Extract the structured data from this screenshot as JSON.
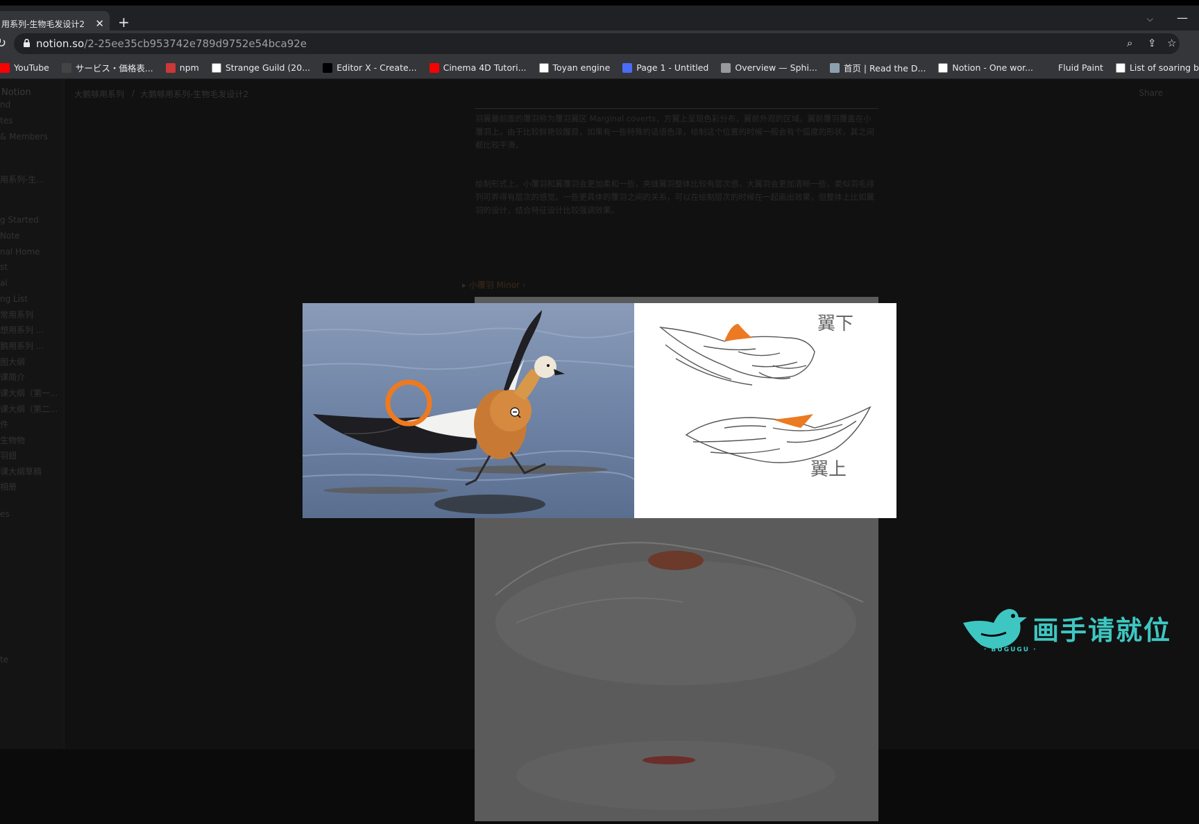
{
  "browser": {
    "tab_title": "用系列-生物毛发设计2",
    "url_host": "notion.so",
    "url_path": "/2-25ee35cb953742e789d9752e54bca92e",
    "bookmarks": [
      {
        "label": "YouTube",
        "icon": "youtube-icon",
        "color": "#ff0000"
      },
      {
        "label": "サービス・価格表...",
        "icon": "price-icon",
        "color": "#444444"
      },
      {
        "label": "npm",
        "icon": "npm-icon",
        "color": "#cb3837"
      },
      {
        "label": "Strange Guild (20...",
        "icon": "strange-guild-icon",
        "color": "#ffffff"
      },
      {
        "label": "Editor X - Create...",
        "icon": "editorx-icon",
        "color": "#000000"
      },
      {
        "label": "Cinema 4D Tutori...",
        "icon": "youtube-icon",
        "color": "#ff0000"
      },
      {
        "label": "Toyan engine",
        "icon": "toyan-icon",
        "color": "#ffffff"
      },
      {
        "label": "Page 1 - Untitled",
        "icon": "layers-icon",
        "color": "#4a6cf7"
      },
      {
        "label": "Overview — Sphi...",
        "icon": "sphinx-icon",
        "color": "#999999"
      },
      {
        "label": "首页 | Read the D...",
        "icon": "readthedocs-icon",
        "color": "#8ca1af"
      },
      {
        "label": "Notion - One wor...",
        "icon": "notion-icon",
        "color": "#ffffff"
      },
      {
        "label": "Fluid Paint",
        "icon": "",
        "color": ""
      },
      {
        "label": "List of soaring bir...",
        "icon": "wikipedia-icon",
        "color": "#ffffff"
      }
    ]
  },
  "notion": {
    "workspace": "Notion",
    "sidebar_items": [
      {
        "label": "nd"
      },
      {
        "label": "tes"
      },
      {
        "label": "& Members"
      },
      {
        "label": "用系列-生..."
      },
      {
        "label": "g Started"
      },
      {
        "label": "Note"
      },
      {
        "label": "nal Home"
      },
      {
        "label": "st"
      },
      {
        "label": "al"
      },
      {
        "label": "ng List"
      },
      {
        "label": "常用系列"
      },
      {
        "label": "想用系列 ..."
      },
      {
        "label": "鹅用系列 ..."
      },
      {
        "label": "图大纲"
      },
      {
        "label": "课简介"
      },
      {
        "label": "课大纲（第一..."
      },
      {
        "label": "课大纲（第二..."
      },
      {
        "label": "件"
      },
      {
        "label": "生物物"
      },
      {
        "label": "羽翅"
      },
      {
        "label": "课大纲草稿"
      },
      {
        "label": "相册"
      },
      {
        "label": "es"
      },
      {
        "label": "te"
      }
    ],
    "breadcrumbs": [
      "大鹅够用系列",
      "/",
      "大鹅够用系列-生物毛发设计2"
    ],
    "share_label": "Share",
    "paragraph_1": "羽翼最前面的覆羽称为覆羽翼区 Marginal coverts，方翼上呈现色彩分布，翼前外观的区域。翼前覆羽覆盖在小覆羽上，由于比较鲜艳较醒目，如果有一些特殊的话语色泽，绘制这个位置的时候一般会有个弧度的形状，其之间都比较平滑。",
    "paragraph_2": "绘制形式上，小覆羽和翼覆羽会更加柔和一些，夹缝翼羽整体比较有层次感，大翼羽会更加清晰一些，类似羽毛排列可弄得有层次的感觉。一些更具体的覆羽之间的关系，可以在绘制层次的时候在一起画出效果，但整体上比如翼羽的设计，结合特征设计比较强调效果。",
    "toggle_label": "▸ 小覆羽 Minor ›"
  },
  "lightbox": {
    "sketch_label_top": "翼下",
    "sketch_label_bottom": "翼上"
  },
  "watermark": {
    "text": "画手请就位",
    "sub": "· BUGUGU ·",
    "color": "#3ec7c2"
  }
}
